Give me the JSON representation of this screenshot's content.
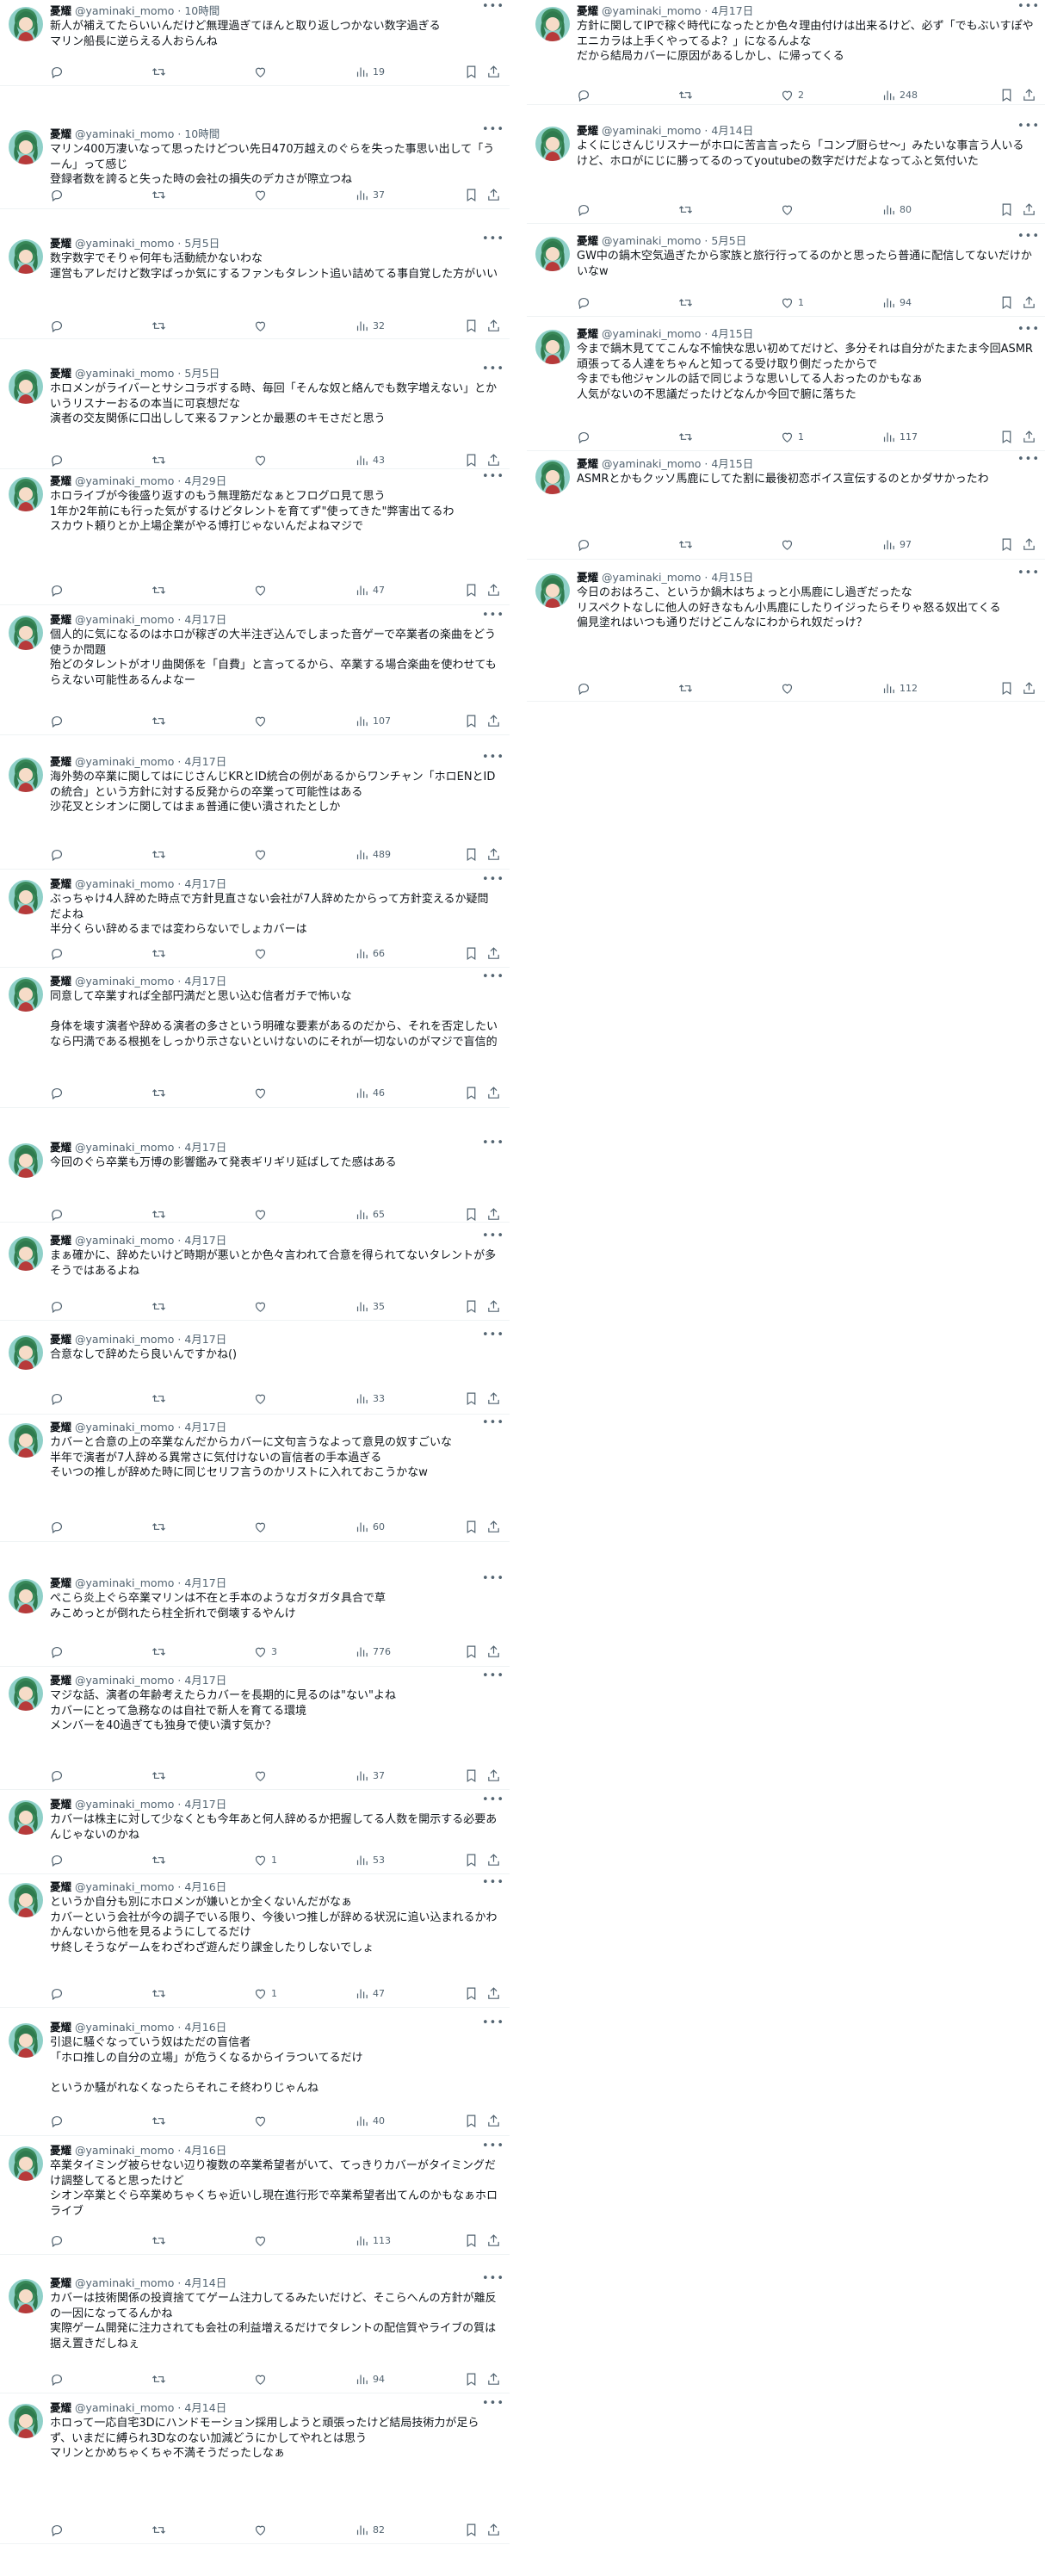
{
  "user": {
    "name": "憂耀",
    "handle": "@yaminaki_momo",
    "sep": "·"
  },
  "icons": {
    "avatar": "avatar-image",
    "more": "more-icon",
    "reply": "reply-icon",
    "retweet": "retweet-icon",
    "like": "heart-icon",
    "views": "views-chart-icon",
    "bookmark": "bookmark-icon",
    "share": "share-icon"
  },
  "left_tweets": [
    {
      "time": "10時間",
      "text": "新人が補えてたらいいんだけど無理過ぎてほんと取り返しつかない数字過ぎる\nマリン船長に逆らえる人おらんね",
      "replies": "",
      "retweets": "",
      "likes": "",
      "views": "19"
    },
    {
      "time": "10時間",
      "text": "マリン400万凄いなって思ったけどつい先日470万越えのぐらを失った事思い出して「うーん」って感じ\n登録者数を誇ると失った時の会社の損失のデカさが際立つね",
      "replies": "",
      "retweets": "",
      "likes": "",
      "views": "37"
    },
    {
      "time": "5月5日",
      "text": "数字数字でそりゃ何年も活動続かないわな\n運営もアレだけど数字ばっか気にするファンもタレント追い詰めてる事自覚した方がいい",
      "replies": "",
      "retweets": "",
      "likes": "",
      "views": "32"
    },
    {
      "time": "5月5日",
      "text": "ホロメンがライバーとサシコラボする時、毎回「そんな奴と絡んでも数字増えない」とかいうリスナーおるの本当に可哀想だな\n演者の交友関係に口出しして来るファンとか最悪のキモさだと思う",
      "replies": "",
      "retweets": "",
      "likes": "",
      "views": "43"
    },
    {
      "time": "4月29日",
      "text": "ホロライブが今後盛り返すのもう無理筋だなぁとフログロ見て思う\n1年か2年前にも行った気がするけどタレントを育てず\"使ってきた\"弊害出てるわ\nスカウト頼りとか上場企業がやる博打じゃないんだよねマジで",
      "replies": "",
      "retweets": "",
      "likes": "",
      "views": "47"
    },
    {
      "time": "4月17日",
      "text": "個人的に気になるのはホロが稼ぎの大半注ぎ込んでしまった音ゲーで卒業者の楽曲をどう使うか問題\n殆どのタレントがオリ曲関係を「自費」と言ってるから、卒業する場合楽曲を使わせてもらえない可能性あるんよなー",
      "replies": "",
      "retweets": "",
      "likes": "",
      "views": "107"
    },
    {
      "time": "4月17日",
      "text": "海外勢の卒業に関してはにじさんじKRとID統合の例があるからワンチャン「ホロENとIDの統合」という方針に対する反発からの卒業って可能性はある\n沙花叉とシオンに関してはまぁ普通に使い潰されたとしか",
      "replies": "",
      "retweets": "",
      "likes": "",
      "views": "489"
    },
    {
      "time": "4月17日",
      "text": "ぶっちゃけ4人辞めた時点で方針見直さない会社が7人辞めたからって方針変えるか疑問だよね\n半分くらい辞めるまでは変わらないでしょカバーは",
      "replies": "",
      "retweets": "",
      "likes": "",
      "views": "66"
    },
    {
      "time": "4月17日",
      "text": "同意して卒業すれば全部円満だと思い込む信者ガチで怖いな\n\n身体を壊す演者や辞める演者の多さという明確な要素があるのだから、それを否定したいなら円満である根拠をしっかり示さないといけないのにそれが一切ないのがマジで盲信的",
      "replies": "",
      "retweets": "",
      "likes": "",
      "views": "46"
    },
    {
      "time": "4月17日",
      "text": "今回のぐら卒業も万博の影響鑑みて発表ギリギリ延ばしてた感はある",
      "replies": "",
      "retweets": "",
      "likes": "",
      "views": "65"
    },
    {
      "time": "4月17日",
      "text": "まぁ確かに、辞めたいけど時期が悪いとか色々言われて合意を得られてないタレントが多そうではあるよね",
      "replies": "",
      "retweets": "",
      "likes": "",
      "views": "35"
    },
    {
      "time": "4月17日",
      "text": "合意なしで辞めたら良いんですかね()",
      "replies": "",
      "retweets": "",
      "likes": "",
      "views": "33"
    },
    {
      "time": "4月17日",
      "text": "カバーと合意の上の卒業なんだからカバーに文句言うなよって意見の奴すごいな\n半年で演者が7人辞める異常さに気付けないの盲信者の手本過ぎる\nそいつの推しが辞めた時に同じセリフ言うのかリストに入れておこうかなw",
      "replies": "",
      "retweets": "",
      "likes": "",
      "views": "60"
    },
    {
      "time": "4月17日",
      "text": "ぺこら炎上ぐら卒業マリンは不在と手本のようなガタガタ具合で草\nみこめっとが倒れたら柱全折れで倒壊するやんけ",
      "replies": "",
      "retweets": "",
      "likes": "3",
      "views": "776"
    },
    {
      "time": "4月17日",
      "text": "マジな話、演者の年齢考えたらカバーを長期的に見るのは\"ない\"よね\nカバーにとって急務なのは自社で新人を育てる環境\nメンバーを40過ぎても独身で使い潰す気か？",
      "replies": "",
      "retweets": "",
      "likes": "",
      "views": "37"
    },
    {
      "time": "4月17日",
      "text": "カバーは株主に対して少なくとも今年あと何人辞めるか把握してる人数を開示する必要あんじゃないのかね",
      "replies": "",
      "retweets": "",
      "likes": "1",
      "views": "53"
    },
    {
      "time": "4月16日",
      "text": "というか自分も別にホロメンが嫌いとか全くないんだがなぁ\nカバーという会社が今の調子でいる限り、今後いつ推しが辞める状況に追い込まれるかわかんないから他を見るようにしてるだけ\nサ終しそうなゲームをわざわざ遊んだり課金したりしないでしょ",
      "replies": "",
      "retweets": "",
      "likes": "1",
      "views": "47"
    },
    {
      "time": "4月16日",
      "text": "引退に騒ぐなっていう奴はただの盲信者\n「ホロ推しの自分の立場」が危うくなるからイラついてるだけ\n\nというか騒がれなくなったらそれこそ終わりじゃんね",
      "replies": "",
      "retweets": "",
      "likes": "",
      "views": "40"
    },
    {
      "time": "4月16日",
      "text": "卒業タイミング被らせない辺り複数の卒業希望者がいて、てっきりカバーがタイミングだけ調整してると思ったけど\nシオン卒業とぐら卒業めちゃくちゃ近いし現在進行形で卒業希望者出てんのかもなぁホロライブ",
      "replies": "",
      "retweets": "",
      "likes": "",
      "views": "113"
    },
    {
      "time": "4月14日",
      "text": "カバーは技術関係の投資捨ててゲーム注力してるみたいだけど、そこらへんの方針が離反の一因になってるんかね\n実際ゲーム開発に注力されても会社の利益増えるだけでタレントの配信質やライブの質は据え置きだしねぇ",
      "replies": "",
      "retweets": "",
      "likes": "",
      "views": "94"
    },
    {
      "time": "4月14日",
      "text": "ホロって一応自宅3Dにハンドモーション採用しようと頑張ったけど結局技術力が足らず、いまだに縛られ3Dなのない加減どうにかしてやれとは思う\nマリンとかめちゃくちゃ不満そうだったしなぁ",
      "replies": "",
      "retweets": "",
      "likes": "",
      "views": "82"
    }
  ],
  "right_tweets": [
    {
      "time": "4月17日",
      "text": "方針に関してIPで稼ぐ時代になったとか色々理由付けは出来るけど、必ず「でもぶいすぽやエニカラは上手くやってるよ？」になるんよな\nだから結局カバーに原因があるしかし、に帰ってくる",
      "replies": "",
      "retweets": "",
      "likes": "2",
      "views": "248"
    },
    {
      "time": "4月14日",
      "text": "よくにじさんじリスナーがホロに苦言言ったら「コンプ厨らせ〜」みたいな事言う人いるけど、ホロがにじに勝ってるのってyoutubeの数字だけだよなってふと気付いた",
      "replies": "",
      "retweets": "",
      "likes": "",
      "views": "80"
    },
    {
      "time": "5月5日",
      "text": "GW中の鍋木空気過ぎたから家族と旅行行ってるのかと思ったら普通に配信してないだけかいなw",
      "replies": "",
      "retweets": "",
      "likes": "1",
      "views": "94"
    },
    {
      "time": "4月15日",
      "text": "今まで鍋木見ててこんな不愉快な思い初めてだけど、多分それは自分がたまたま今回ASMR頑張ってる人達をちゃんと知ってる受け取り側だったからで\n今までも他ジャンルの話で同じような思いしてる人おったのかもなぁ\n人気がないの不思議だったけどなんか今回で腑に落ちた",
      "replies": "",
      "retweets": "",
      "likes": "1",
      "views": "117"
    },
    {
      "time": "4月15日",
      "text": "ASMRとかもクッソ馬鹿にしてた割に最後初恋ボイス宣伝するのとかダサかったわ",
      "replies": "",
      "retweets": "",
      "likes": "",
      "views": "97"
    },
    {
      "time": "4月15日",
      "text": "今日のおはろこ、というか鍋木はちょっと小馬鹿にし過ぎだったな\nリスペクトなしに他人の好きなもん小馬鹿にしたりイジったらそりゃ怒る奴出てくる\n偏見塗れはいつも通りだけどこんなにわかられ奴だっけ？",
      "replies": "",
      "retweets": "",
      "likes": "",
      "views": "112"
    }
  ]
}
